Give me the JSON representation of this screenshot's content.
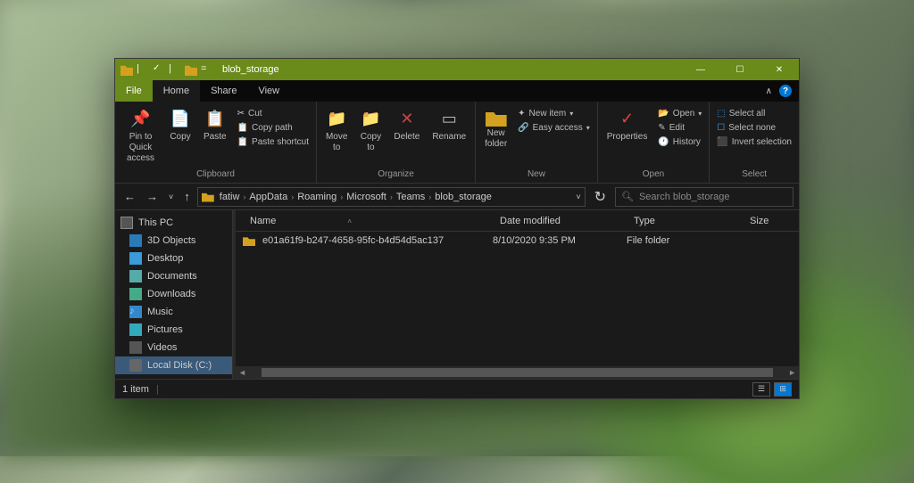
{
  "window": {
    "title": "blob_storage",
    "controls": {
      "minimize": "—",
      "maximize": "☐",
      "close": "✕"
    }
  },
  "menu": {
    "file": "File",
    "home": "Home",
    "share": "Share",
    "view": "View"
  },
  "ribbon": {
    "clipboard": {
      "label": "Clipboard",
      "pin_quick": "Pin to Quick\naccess",
      "copy": "Copy",
      "paste": "Paste",
      "cut": "Cut",
      "copy_path": "Copy path",
      "paste_shortcut": "Paste shortcut"
    },
    "organize": {
      "label": "Organize",
      "move_to": "Move\nto",
      "copy_to": "Copy\nto",
      "delete": "Delete",
      "rename": "Rename"
    },
    "new": {
      "label": "New",
      "new_folder": "New\nfolder",
      "new_item": "New item",
      "easy_access": "Easy access"
    },
    "open": {
      "label": "Open",
      "properties": "Properties",
      "open": "Open",
      "edit": "Edit",
      "history": "History"
    },
    "select": {
      "label": "Select",
      "select_all": "Select all",
      "select_none": "Select none",
      "invert_selection": "Invert selection"
    }
  },
  "breadcrumb": {
    "items": [
      "fatiw",
      "AppData",
      "Roaming",
      "Microsoft",
      "Teams",
      "blob_storage"
    ]
  },
  "search": {
    "placeholder": "Search blob_storage"
  },
  "sidebar": {
    "this_pc": "This PC",
    "items": [
      "3D Objects",
      "Desktop",
      "Documents",
      "Downloads",
      "Music",
      "Pictures",
      "Videos",
      "Local Disk (C:)"
    ]
  },
  "columns": {
    "name": "Name",
    "date": "Date modified",
    "type": "Type",
    "size": "Size"
  },
  "files": [
    {
      "name": "e01a61f9-b247-4658-95fc-b4d54d5ac137",
      "date": "8/10/2020 9:35 PM",
      "type": "File folder",
      "size": ""
    }
  ],
  "status": {
    "count": "1 item"
  }
}
